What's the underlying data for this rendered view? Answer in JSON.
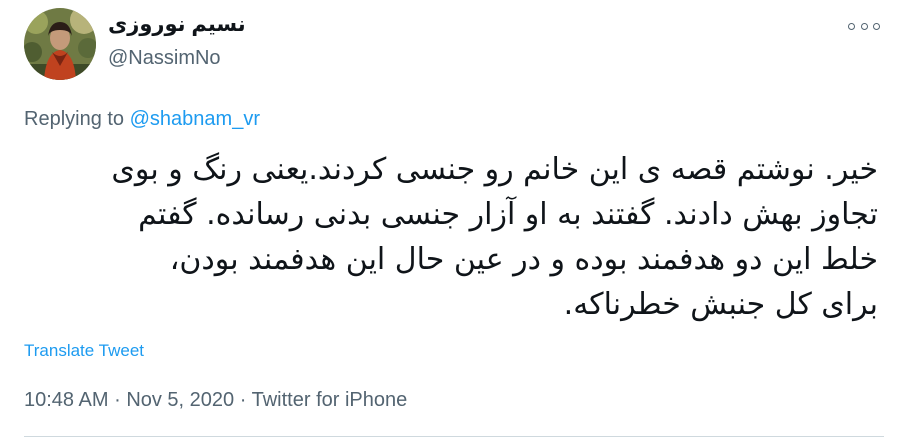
{
  "user": {
    "display_name": "نسیم نوروزی",
    "handle": "@NassimNo",
    "avatar_icon": "profile-photo"
  },
  "menu": {
    "more_icon": "more-options-icon"
  },
  "reply": {
    "prefix": "Replying to",
    "mention": "@shabnam_vr"
  },
  "tweet": {
    "lines": [
      "خیر. نوشتم قصه ی این خانم رو جنسی کردند.یعنی رنگ و بوی",
      "تجاوز بهش دادند. گفتند به او آزار جنسی بدنی رسانده. گفتم",
      "خلط این دو هدفمند بوده و در عین حال این هدفمند بودن،",
      "برای کل جنبش خطرناکه."
    ]
  },
  "translate_label": "Translate Tweet",
  "meta": {
    "time": "10:48 AM",
    "separator": "·",
    "date": "Nov 5, 2020",
    "source": "Twitter for iPhone"
  },
  "colors": {
    "text": "#0f1419",
    "secondary": "#536471",
    "accent": "#1d9bf0",
    "divider": "#cfd9de"
  }
}
